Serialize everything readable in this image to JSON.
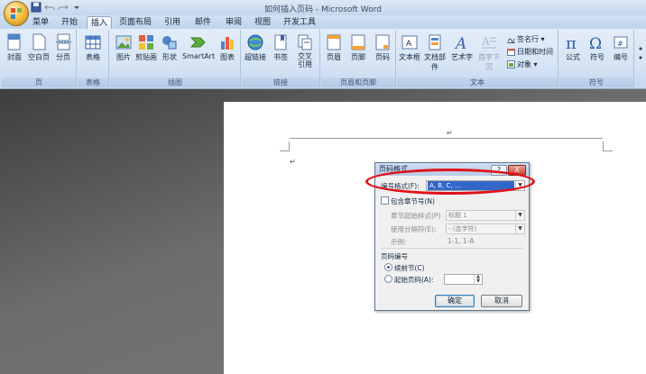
{
  "window": {
    "title": "如何插入页码 - Microsoft Word"
  },
  "menu_tabs": [
    "菜单",
    "开始",
    "插入",
    "页面布局",
    "引用",
    "邮件",
    "审阅",
    "视图",
    "开发工具"
  ],
  "active_tab": "插入",
  "ribbon": {
    "groups": {
      "pages": {
        "label": "页",
        "buttons": [
          "封面",
          "空白页",
          "分页"
        ]
      },
      "tables": {
        "label": "表格",
        "buttons": [
          "表格"
        ]
      },
      "illustrations": {
        "label": "插图",
        "buttons": [
          "图片",
          "剪贴画",
          "形状",
          "SmartArt",
          "图表"
        ]
      },
      "links": {
        "label": "链接",
        "buttons": [
          "超链接",
          "书签",
          "交叉引用"
        ]
      },
      "header_footer": {
        "label": "页眉和页脚",
        "buttons": [
          "页眉",
          "页脚",
          "页码"
        ]
      },
      "text": {
        "label": "文本",
        "buttons": [
          "文本框",
          "文档部件",
          "艺术字",
          "首字下沉"
        ],
        "small": [
          "签名行",
          "日期和时间",
          "对象"
        ]
      },
      "symbols": {
        "label": "符号",
        "buttons": [
          "公式",
          "符号",
          "编号"
        ]
      }
    }
  },
  "dialog": {
    "title": "页码格式",
    "help": "?",
    "close": "X",
    "number_format_label": "编号格式(F):",
    "number_format_value": "A, B, C, ...",
    "include_chapter_label": "包含章节号(N)",
    "chapter_start_style_label": "章节起始样式(P)",
    "chapter_start_style_value": "标题 1",
    "separator_label": "使用分隔符(E):",
    "separator_value": "-  (连字符)",
    "example_label": "示例:",
    "example_value": "1-1, 1-A",
    "page_numbering_label": "页码编号",
    "continue_label": "续前节(C)",
    "start_at_label": "起始页码(A):",
    "start_at_value": "",
    "ok": "确定",
    "cancel": "取消"
  },
  "document": {
    "para_marks": [
      "↵",
      "↵"
    ]
  },
  "colors": {
    "annotation": "#e0121b",
    "selection": "#3367c7"
  }
}
